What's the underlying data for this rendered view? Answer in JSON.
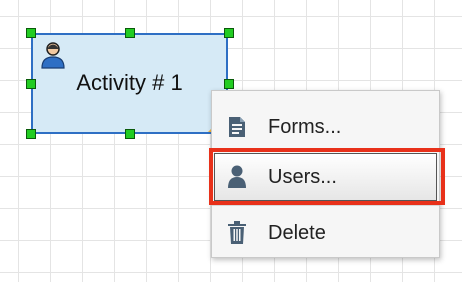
{
  "canvas": {
    "activity": {
      "title": "Activity # 1",
      "icon": "user-icon",
      "selected": true,
      "fill_color": "#d6eaf6",
      "border_color": "#2e6fc4"
    }
  },
  "context_menu": {
    "items": [
      {
        "label": "Forms...",
        "icon": "form-document-icon"
      },
      {
        "label": "Users...",
        "icon": "user-icon",
        "highlighted": true
      },
      {
        "label": "Delete",
        "icon": "trash-icon"
      }
    ],
    "highlight_outline_color": "#e8311a"
  }
}
